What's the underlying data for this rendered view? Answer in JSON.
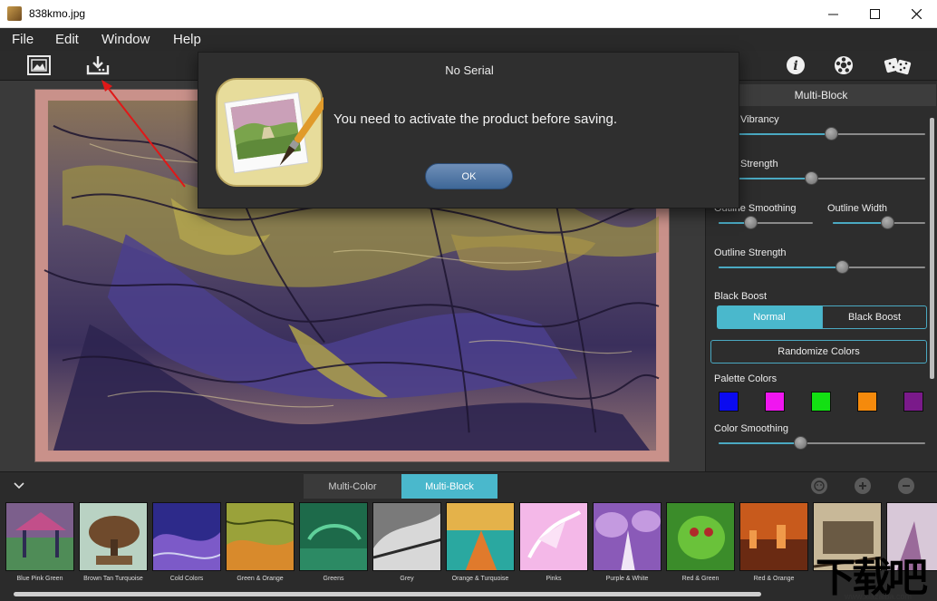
{
  "window": {
    "title": "838kmo.jpg",
    "icon": "photo-icon",
    "controls": [
      "minimize",
      "maximize",
      "close"
    ]
  },
  "menu": [
    "File",
    "Edit",
    "Window",
    "Help"
  ],
  "toolbar": {
    "left_icons": [
      "open-image-icon",
      "save-download-icon"
    ],
    "right_icons": [
      "info-icon",
      "settings-icon",
      "random-dice-icon"
    ]
  },
  "dialog": {
    "title": "No Serial",
    "message": "You need to activate the product before saving.",
    "ok_label": "OK"
  },
  "panel": {
    "title": "Multi-Block",
    "sliders": {
      "vibrancy": {
        "label": "Vibrancy",
        "value": 0.55
      },
      "strength": {
        "label": "Strength",
        "value": 0.45
      },
      "outline_smoothing": {
        "label": "Outline Smoothing",
        "value": 0.35
      },
      "outline_width": {
        "label": "Outline Width",
        "value": 0.6
      },
      "outline_strength": {
        "label": "Outline Strength",
        "value": 0.6
      },
      "color_smoothing": {
        "label": "Color Smoothing",
        "value": 0.4
      }
    },
    "black_boost": {
      "label": "Black Boost",
      "options": [
        "Normal",
        "Black Boost"
      ],
      "selected": "Normal"
    },
    "randomize_label": "Randomize Colors",
    "palette_label": "Palette Colors",
    "palette": [
      "#0b0bf0",
      "#f016f0",
      "#13e013",
      "#f58a0c",
      "#7a1a8a"
    ],
    "accent": "#4ab8cc"
  },
  "bottom": {
    "tabs": [
      "Multi-Color",
      "Multi-Block"
    ],
    "active_tab": "Multi-Block",
    "actions": [
      "face-icon",
      "add-icon",
      "remove-icon"
    ]
  },
  "presets": [
    "Blue Pink Green",
    "Brown Tan Turquoise",
    "Cold Colors",
    "Green & Orange",
    "Greens",
    "Grey",
    "Orange & Turquoise",
    "Pinks",
    "Purple & White",
    "Red & Green",
    "Red & Orange",
    "",
    ""
  ],
  "watermark": {
    "text": "下载吧",
    "url": "www.xiazaiba.com"
  }
}
